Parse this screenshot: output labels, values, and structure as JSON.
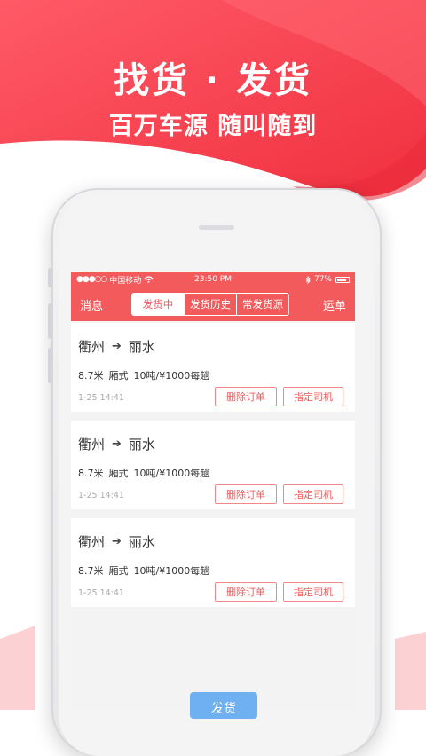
{
  "promo": {
    "headline": "找货 · 发货",
    "subheadline": "百万车源 随叫随到"
  },
  "statusbar": {
    "carrier": "中国移动",
    "time": "23:50 PM",
    "battery": "77%"
  },
  "navbar": {
    "left": "消息",
    "right": "运单",
    "tabs": [
      {
        "label": "发货中"
      },
      {
        "label": "发货历史"
      },
      {
        "label": "常发货源"
      }
    ]
  },
  "orders": [
    {
      "from": "衢州",
      "to": "丽水",
      "length": "8.7米",
      "type": "厢式",
      "load": "10吨/¥1000每趟",
      "date": "1-25 14:41",
      "delete_label": "删除订单",
      "assign_label": "指定司机"
    },
    {
      "from": "衢州",
      "to": "丽水",
      "length": "8.7米",
      "type": "厢式",
      "load": "10吨/¥1000每趟",
      "date": "1-25 14:41",
      "delete_label": "删除订单",
      "assign_label": "指定司机"
    },
    {
      "from": "衢州",
      "to": "丽水",
      "length": "8.7米",
      "type": "厢式",
      "load": "10吨/¥1000每趟",
      "date": "1-25 14:41",
      "delete_label": "删除订单",
      "assign_label": "指定司机"
    }
  ],
  "publish_button": "发货",
  "colors": {
    "brand_red": "#f25a5b",
    "button_blue": "#6fb1f0"
  }
}
